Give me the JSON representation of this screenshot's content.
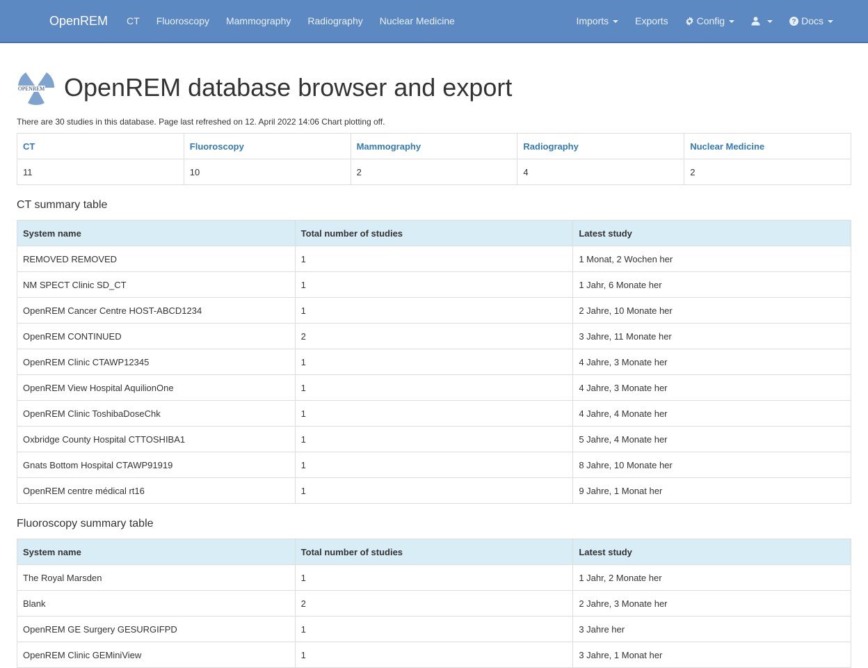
{
  "nav": {
    "brand": "OpenREM",
    "left_links": [
      "CT",
      "Fluoroscopy",
      "Mammography",
      "Radiography",
      "Nuclear Medicine"
    ],
    "imports": "Imports",
    "exports": "Exports",
    "config": "Config",
    "docs": "Docs"
  },
  "header": {
    "logo_text": "OPENREM",
    "title": "OpenREM database browser and export",
    "intro": "There are 30 studies in this database. Page last refreshed on 12. April 2022 14:06 Chart plotting off."
  },
  "modalities": {
    "labels": [
      "CT",
      "Fluoroscopy",
      "Mammography",
      "Radiography",
      "Nuclear Medicine"
    ],
    "counts": [
      "11",
      "10",
      "2",
      "4",
      "2"
    ]
  },
  "ct": {
    "title": "CT summary table",
    "headers": [
      "System name",
      "Total number of studies",
      "Latest study"
    ],
    "rows": [
      [
        "REMOVED REMOVED",
        "1",
        "1 Monat, 2 Wochen her"
      ],
      [
        "NM SPECT Clinic SD_CT",
        "1",
        "1 Jahr, 6 Monate her"
      ],
      [
        "OpenREM Cancer Centre HOST-ABCD1234",
        "1",
        "2 Jahre, 10 Monate her"
      ],
      [
        "OpenREM CONTINUED",
        "2",
        "3 Jahre, 11 Monate her"
      ],
      [
        "OpenREM Clinic CTAWP12345",
        "1",
        "4 Jahre, 3 Monate her"
      ],
      [
        "OpenREM View Hospital AquilionOne",
        "1",
        "4 Jahre, 3 Monate her"
      ],
      [
        "OpenREM Clinic ToshibaDoseChk",
        "1",
        "4 Jahre, 4 Monate her"
      ],
      [
        "Oxbridge County Hospital CTTOSHIBA1",
        "1",
        "5 Jahre, 4 Monate her"
      ],
      [
        "Gnats Bottom Hospital CTAWP91919",
        "1",
        "8 Jahre, 10 Monate her"
      ],
      [
        "OpenREM centre médical rt16",
        "1",
        "9 Jahre, 1 Monat her"
      ]
    ]
  },
  "fluoro": {
    "title": "Fluoroscopy summary table",
    "headers": [
      "System name",
      "Total number of studies",
      "Latest study"
    ],
    "rows": [
      [
        "The Royal Marsden",
        "1",
        "1 Jahr, 2 Monate her"
      ],
      [
        "Blank",
        "2",
        "2 Jahre, 3 Monate her"
      ],
      [
        "OpenREM GE Surgery GESURGIFPD",
        "1",
        "3 Jahre her"
      ],
      [
        "OpenREM Clinic GEMiniView",
        "1",
        "3 Jahre, 1 Monat her"
      ]
    ]
  }
}
